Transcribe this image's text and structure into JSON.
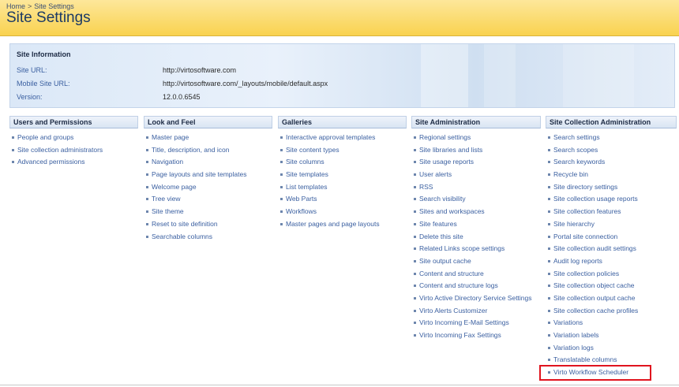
{
  "breadcrumb": [
    "Home",
    "Site Settings"
  ],
  "breadcrumb_sep": ">",
  "title": "Site Settings",
  "site_information": {
    "heading": "Site Information",
    "rows": [
      {
        "label": "Site URL:",
        "value": "http://virtosoftware.com"
      },
      {
        "label": "Mobile Site URL:",
        "value": "http://virtosoftware.com/_layouts/mobile/default.aspx"
      },
      {
        "label": "Version:",
        "value": "12.0.0.6545"
      }
    ]
  },
  "columns": [
    {
      "heading": "Users and Permissions",
      "items": [
        "People and groups",
        "Site collection administrators",
        "Advanced permissions"
      ]
    },
    {
      "heading": "Look and Feel",
      "items": [
        "Master page",
        "Title, description, and icon",
        "Navigation",
        "Page layouts and site templates",
        "Welcome page",
        "Tree view",
        "Site theme",
        "Reset to site definition",
        "Searchable columns"
      ]
    },
    {
      "heading": "Galleries",
      "items": [
        "Interactive approval templates",
        "Site content types",
        "Site columns",
        "Site templates",
        "List templates",
        "Web Parts",
        "Workflows",
        "Master pages and page layouts"
      ]
    },
    {
      "heading": "Site Administration",
      "items": [
        "Regional settings",
        "Site libraries and lists",
        "Site usage reports",
        "User alerts",
        "RSS",
        "Search visibility",
        "Sites and workspaces",
        "Site features",
        "Delete this site",
        "Related Links scope settings",
        "Site output cache",
        "Content and structure",
        "Content and structure logs",
        "Virto Active Directory Service Settings",
        "Virto Alerts Customizer",
        "Virto Incoming E-Mail Settings",
        "Virto Incoming Fax Settings"
      ]
    },
    {
      "heading": "Site Collection Administration",
      "items": [
        "Search settings",
        "Search scopes",
        "Search keywords",
        "Recycle bin",
        "Site directory settings",
        "Site collection usage reports",
        "Site collection features",
        "Site hierarchy",
        "Portal site connection",
        "Site collection audit settings",
        "Audit log reports",
        "Site collection policies",
        "Site collection object cache",
        "Site collection output cache",
        "Site collection cache profiles",
        "Variations",
        "Variation labels",
        "Variation logs",
        "Translatable columns",
        "Virto Workflow Scheduler"
      ]
    }
  ],
  "colors": {
    "header_top": "#fde79a",
    "header_bottom": "#f9d24f",
    "title": "#1d3a64",
    "link": "#3a5fa0",
    "highlight": "#e0141e"
  }
}
